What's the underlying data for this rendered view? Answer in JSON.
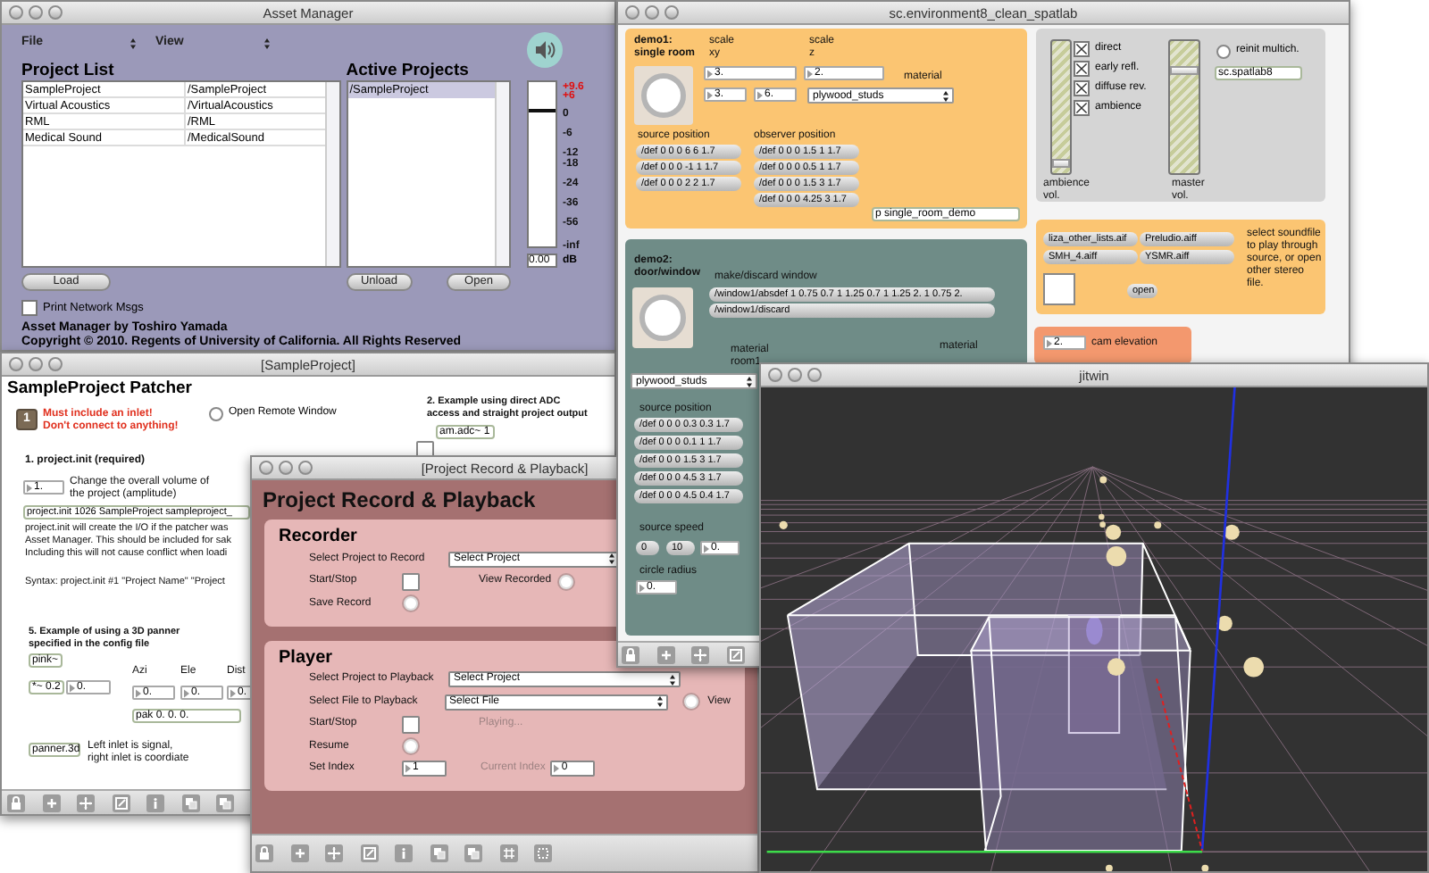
{
  "asset_manager": {
    "title": "Asset Manager",
    "menus": [
      {
        "label": "File"
      },
      {
        "label": "View"
      }
    ],
    "project_list": {
      "heading": "Project List",
      "rows": [
        {
          "name": "SampleProject",
          "path": "/SampleProject"
        },
        {
          "name": "Virtual Acoustics",
          "path": "/VirtualAcoustics"
        },
        {
          "name": "RML",
          "path": "/RML"
        },
        {
          "name": "Medical Sound",
          "path": "/MedicalSound"
        }
      ]
    },
    "active_projects": {
      "heading": "Active Projects",
      "items": [
        {
          "label": "/SampleProject",
          "selected": true
        }
      ]
    },
    "meter": {
      "level": 0.82,
      "value": "0.00",
      "unit": "dB",
      "scale": [
        {
          "text": "+9.6",
          "kind": "clip"
        },
        {
          "text": "+6",
          "kind": "clip"
        },
        {
          "text": "0",
          "kind": "mark"
        },
        {
          "text": "-6",
          "kind": "mark"
        },
        {
          "text": "-12",
          "kind": "mark"
        },
        {
          "text": "-18",
          "kind": "mark"
        },
        {
          "text": "-24",
          "kind": "mark"
        },
        {
          "text": "-36",
          "kind": "mark"
        },
        {
          "text": "-56",
          "kind": "mark"
        },
        {
          "text": "-inf",
          "kind": "mark"
        }
      ]
    },
    "buttons": [
      {
        "label": "Load"
      },
      {
        "label": "Unload"
      },
      {
        "label": "Open"
      }
    ],
    "print_network_msgs": {
      "label": "Print Network Msgs",
      "checked": false
    },
    "credits": [
      "Asset Manager by Toshiro Yamada",
      "Copyright © 2010. Regents of University of California. All Rights Reserved"
    ]
  },
  "sample_project": {
    "title": "[SampleProject]",
    "items": [
      {
        "kind": "heading",
        "text": "SampleProject Patcher"
      },
      {
        "kind": "inlet",
        "text": "1"
      },
      {
        "kind": "warning",
        "text": "Must include an inlet!\nDon't connect to anything!"
      },
      {
        "kind": "radio",
        "label": "Open Remote Window",
        "selected": false
      },
      {
        "kind": "bold_comment",
        "text": "2. Example using direct ADC\naccess and straight project output"
      },
      {
        "kind": "object",
        "text": "am.adc~ 1"
      },
      {
        "kind": "toggle",
        "checked": false
      },
      {
        "kind": "bold_comment",
        "text": "1. project.init (required)"
      },
      {
        "kind": "number",
        "text": "1."
      },
      {
        "kind": "comment",
        "text": "Change the overall volume of\nthe project (amplitude)"
      },
      {
        "kind": "object",
        "text": "project.init 1026 SampleProject sampleproject_"
      },
      {
        "kind": "comment",
        "text": "project.init will create the I/O if the patcher was\nAsset Manager. This should be included for sak\nIncluding this will not cause conflict when loadi"
      },
      {
        "kind": "comment",
        "text": "Syntax: project.init #1 \"Project Name\" \"Project"
      },
      {
        "kind": "bold_comment",
        "text": "5. Example of using a 3D panner\nspecified in the config file"
      },
      {
        "kind": "object",
        "text": "pink~"
      },
      {
        "kind": "object",
        "text": "*~ 0.2"
      },
      {
        "kind": "number",
        "text": "0."
      },
      {
        "kind": "comment",
        "text": "Azi"
      },
      {
        "kind": "comment",
        "text": "Ele"
      },
      {
        "kind": "comment",
        "text": "Dist"
      },
      {
        "kind": "number",
        "text": "0."
      },
      {
        "kind": "number",
        "text": "0."
      },
      {
        "kind": "number",
        "text": "0."
      },
      {
        "kind": "object",
        "text": "pak 0. 0. 0."
      },
      {
        "kind": "object",
        "text": "panner.3d"
      },
      {
        "kind": "comment",
        "text": "Left inlet is signal,\nright inlet is coordiate"
      }
    ]
  },
  "record_playback": {
    "title": "[Project Record & Playback]",
    "heading": "Project Record & Playback",
    "panels": [
      {
        "heading": "Recorder",
        "rows": [
          {
            "items": [
              {
                "kind": "label",
                "text": "Select Project to Record",
                "disabled": false
              },
              {
                "kind": "dropdown",
                "value": "Select Project"
              }
            ]
          },
          {
            "items": [
              {
                "kind": "label",
                "text": "Start/Stop",
                "disabled": false
              },
              {
                "kind": "checkbox",
                "checked": false
              },
              {
                "kind": "label",
                "text": "View Recorded",
                "disabled": false
              },
              {
                "kind": "radio",
                "selected": false
              }
            ]
          },
          {
            "items": [
              {
                "kind": "label",
                "text": "Save Record",
                "disabled": false
              },
              {
                "kind": "radio",
                "selected": false
              }
            ]
          }
        ]
      },
      {
        "heading": "Player",
        "rows": [
          {
            "items": [
              {
                "kind": "label",
                "text": "Select Project to Playback",
                "disabled": false
              },
              {
                "kind": "dropdown",
                "value": "Select Project"
              }
            ]
          },
          {
            "items": [
              {
                "kind": "label",
                "text": "Select File to Playback",
                "disabled": false
              },
              {
                "kind": "dropdown",
                "value": "Select File"
              },
              {
                "kind": "radio",
                "selected": false
              },
              {
                "kind": "label",
                "text": "View",
                "disabled": false
              }
            ]
          },
          {
            "items": [
              {
                "kind": "label",
                "text": "Start/Stop",
                "disabled": false
              },
              {
                "kind": "checkbox",
                "checked": false
              },
              {
                "kind": "label",
                "text": "Playing...",
                "disabled": true
              }
            ]
          },
          {
            "items": [
              {
                "kind": "label",
                "text": "Resume",
                "disabled": false
              },
              {
                "kind": "radio",
                "selected": false
              }
            ]
          },
          {
            "items": [
              {
                "kind": "label",
                "text": "Set Index",
                "disabled": false
              },
              {
                "kind": "number",
                "text": "1"
              },
              {
                "kind": "label",
                "text": "Current Index",
                "disabled": true
              },
              {
                "kind": "number",
                "text": "0"
              }
            ]
          }
        ]
      }
    ]
  },
  "environment": {
    "title": "sc.environment8_clean_spatlab",
    "panels": [
      {
        "items": [
          {
            "kind": "bold_comment",
            "text": "demo1:\nsingle room"
          },
          {
            "kind": "comment",
            "text": "scale\nxy"
          },
          {
            "kind": "comment",
            "text": "scale\nz"
          },
          {
            "kind": "dial"
          },
          {
            "kind": "number",
            "text": "3."
          },
          {
            "kind": "number",
            "text": "2."
          },
          {
            "kind": "comment",
            "text": "material"
          },
          {
            "kind": "number",
            "text": "3."
          },
          {
            "kind": "number",
            "text": "6."
          },
          {
            "kind": "dropdown",
            "text": "plywood_studs"
          },
          {
            "kind": "comment",
            "text": "source position"
          },
          {
            "kind": "comment",
            "text": "observer position"
          },
          {
            "kind": "message",
            "text": "/def 0 0 0 6 6 1.7"
          },
          {
            "kind": "message",
            "text": "/def 0 0 0 -1 1 1.7"
          },
          {
            "kind": "message",
            "text": "/def 0 0 0 2 2 1.7"
          },
          {
            "kind": "message",
            "text": "/def 0 0 0 1.5 1 1.7"
          },
          {
            "kind": "message",
            "text": "/def 0 0 0 0.5 1 1.7"
          },
          {
            "kind": "message",
            "text": "/def 0 0 0 1.5 3 1.7"
          },
          {
            "kind": "message",
            "text": "/def 0 0 0 4.25 3 1.7"
          },
          {
            "kind": "object",
            "text": "p single_room_demo"
          }
        ]
      },
      {
        "items": [
          {
            "kind": "slider",
            "level": 0.05
          },
          {
            "kind": "checkbox",
            "label": "direct",
            "checked": true
          },
          {
            "kind": "checkbox",
            "label": "early refl.",
            "checked": true
          },
          {
            "kind": "checkbox",
            "label": "diffuse rev.",
            "checked": true
          },
          {
            "kind": "checkbox",
            "label": "ambience",
            "checked": true
          },
          {
            "kind": "comment",
            "text": "ambience\nvol."
          },
          {
            "kind": "slider",
            "level": 0.8
          },
          {
            "kind": "comment",
            "text": "master\nvol."
          },
          {
            "kind": "radio",
            "label": "reinit multich.",
            "selected": false
          },
          {
            "kind": "object",
            "text": "sc.spatlab8"
          }
        ]
      },
      {
        "items": [
          {
            "kind": "message",
            "text": "liza_other_lists.aif"
          },
          {
            "kind": "message",
            "text": "Preludio.aiff"
          },
          {
            "kind": "message",
            "text": "SMH_4.aiff"
          },
          {
            "kind": "message",
            "text": "YSMR.aiff"
          },
          {
            "kind": "drop_box"
          },
          {
            "kind": "message",
            "text": "open"
          },
          {
            "kind": "comment",
            "text": "select soundfile to play through source, or open other stereo file."
          }
        ]
      },
      {
        "items": [
          {
            "kind": "number",
            "text": "2."
          },
          {
            "kind": "comment",
            "text": "cam elevation"
          }
        ]
      },
      {
        "items": [
          {
            "kind": "bold_comment",
            "text": "demo2:\ndoor/window"
          },
          {
            "kind": "comment",
            "text": "make/discard window"
          },
          {
            "kind": "message",
            "text": "/window1/absdef 1 0.75 0.7 1 1.25 0.7 1 1.25 2. 1 0.75 2."
          },
          {
            "kind": "message",
            "text": "/window1/discard"
          },
          {
            "kind": "dial"
          },
          {
            "kind": "comment",
            "text": "material\nroom1"
          },
          {
            "kind": "comment",
            "text": "material"
          },
          {
            "kind": "dropdown",
            "text": "plywood_studs"
          },
          {
            "kind": "comment",
            "text": "source position"
          },
          {
            "kind": "message",
            "text": "/def 0 0 0 0.3 0.3 1.7"
          },
          {
            "kind": "message",
            "text": "/def 0 0 0 0.1 1 1.7"
          },
          {
            "kind": "message",
            "text": "/def 0 0 0 1.5 3 1.7"
          },
          {
            "kind": "message",
            "text": "/def 0 0 0 4.5 3 1.7"
          },
          {
            "kind": "message",
            "text": "/def 0 0 0 4.5 0.4 1.7"
          },
          {
            "kind": "comment",
            "text": "source speed"
          },
          {
            "kind": "message",
            "text": "0"
          },
          {
            "kind": "message",
            "text": "10"
          },
          {
            "kind": "number",
            "text": "0."
          },
          {
            "kind": "comment",
            "text": "circle radius"
          },
          {
            "kind": "number",
            "text": "0."
          }
        ]
      }
    ]
  },
  "jitwin": {
    "title": "jitwin"
  }
}
